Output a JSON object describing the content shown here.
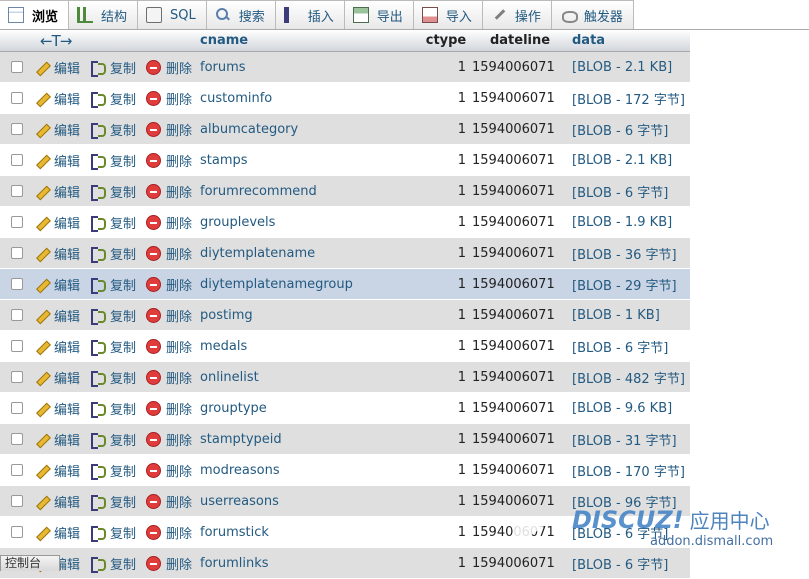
{
  "tabs": [
    {
      "label": "浏览",
      "icon": "browse-icon",
      "active": true
    },
    {
      "label": "结构",
      "icon": "structure-icon"
    },
    {
      "label": "SQL",
      "icon": "sql-icon"
    },
    {
      "label": "搜索",
      "icon": "search-icon"
    },
    {
      "label": "插入",
      "icon": "insert-icon"
    },
    {
      "label": "导出",
      "icon": "export-icon"
    },
    {
      "label": "导入",
      "icon": "import-icon"
    },
    {
      "label": "操作",
      "icon": "wrench-icon"
    },
    {
      "label": "触发器",
      "icon": "trigger-icon"
    }
  ],
  "table": {
    "arrows": "←T→",
    "columns": {
      "cname": "cname",
      "ctype": "ctype",
      "dateline": "dateline",
      "data": "data"
    },
    "actions": {
      "edit": "编辑",
      "copy": "复制",
      "delete": "删除"
    },
    "rows": [
      {
        "cname": "forums",
        "ctype": "1",
        "dateline": "1594006071",
        "data": "[BLOB - 2.1 KB]"
      },
      {
        "cname": "custominfo",
        "ctype": "1",
        "dateline": "1594006071",
        "data": "[BLOB - 172 字节]"
      },
      {
        "cname": "albumcategory",
        "ctype": "1",
        "dateline": "1594006071",
        "data": "[BLOB - 6 字节]"
      },
      {
        "cname": "stamps",
        "ctype": "1",
        "dateline": "1594006071",
        "data": "[BLOB - 2.1 KB]"
      },
      {
        "cname": "forumrecommend",
        "ctype": "1",
        "dateline": "1594006071",
        "data": "[BLOB - 6 字节]"
      },
      {
        "cname": "grouplevels",
        "ctype": "1",
        "dateline": "1594006071",
        "data": "[BLOB - 1.9 KB]"
      },
      {
        "cname": "diytemplatename",
        "ctype": "1",
        "dateline": "1594006071",
        "data": "[BLOB - 36 字节]"
      },
      {
        "cname": "diytemplatenamegroup",
        "ctype": "1",
        "dateline": "1594006071",
        "data": "[BLOB - 29 字节]",
        "highlight": true
      },
      {
        "cname": "postimg",
        "ctype": "1",
        "dateline": "1594006071",
        "data": "[BLOB - 1 KB]"
      },
      {
        "cname": "medals",
        "ctype": "1",
        "dateline": "1594006071",
        "data": "[BLOB - 6 字节]"
      },
      {
        "cname": "onlinelist",
        "ctype": "1",
        "dateline": "1594006071",
        "data": "[BLOB - 482 字节]"
      },
      {
        "cname": "grouptype",
        "ctype": "1",
        "dateline": "1594006071",
        "data": "[BLOB - 9.6 KB]"
      },
      {
        "cname": "stamptypeid",
        "ctype": "1",
        "dateline": "1594006071",
        "data": "[BLOB - 31 字节]"
      },
      {
        "cname": "modreasons",
        "ctype": "1",
        "dateline": "1594006071",
        "data": "[BLOB - 170 字节]"
      },
      {
        "cname": "userreasons",
        "ctype": "1",
        "dateline": "1594006071",
        "data": "[BLOB - 96 字节]"
      },
      {
        "cname": "forumstick",
        "ctype": "1",
        "dateline": "1594006071",
        "data": "[BLOB - 6 字节]"
      },
      {
        "cname": "forumlinks",
        "ctype": "1",
        "dateline": "1594006071",
        "data": "[BLOB - 6 字节]"
      }
    ]
  },
  "watermark": {
    "logo": "DISCUZ!",
    "logo_cn": "应用中心",
    "url": "addon.dismall.com"
  },
  "console": {
    "label": "控制台"
  }
}
